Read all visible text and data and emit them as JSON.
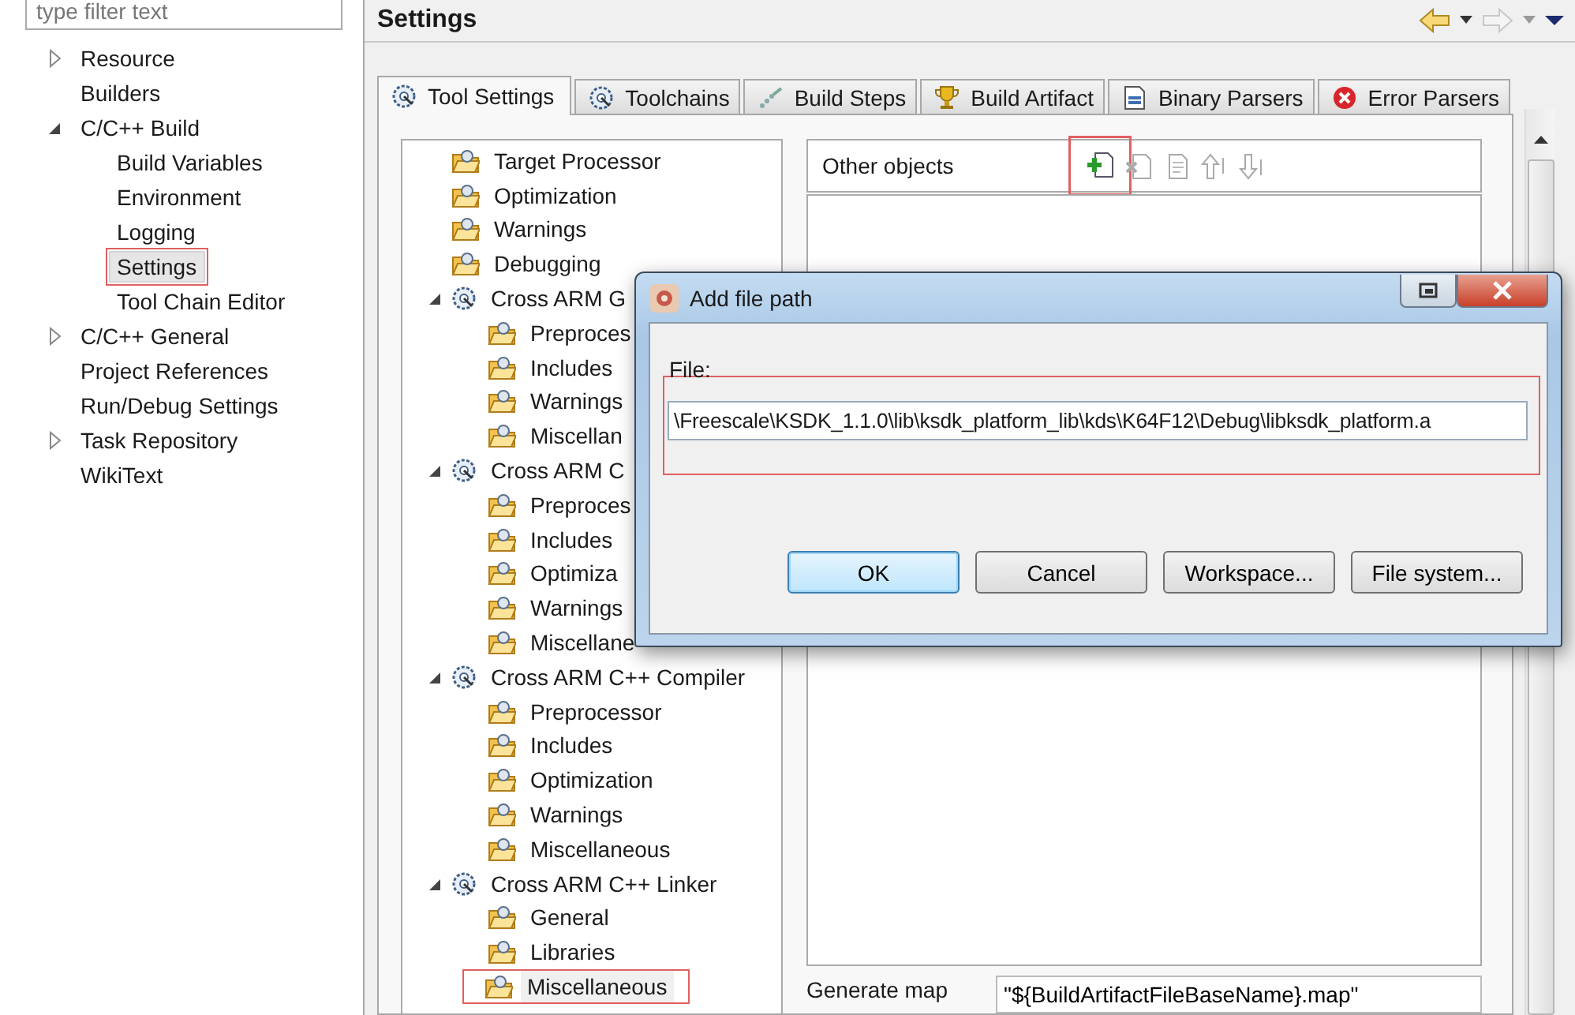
{
  "filter": {
    "placeholder": "type filter text"
  },
  "nav": [
    {
      "label": "Resource",
      "expanded": false,
      "selected": false,
      "marked": false
    },
    {
      "label": "Builders",
      "selected": false,
      "marked": false
    },
    {
      "label": "C/C++ Build",
      "expanded": true,
      "selected": false,
      "marked": false,
      "children": [
        {
          "label": "Build Variables",
          "selected": false,
          "marked": false
        },
        {
          "label": "Environment",
          "selected": false,
          "marked": false
        },
        {
          "label": "Logging",
          "selected": false,
          "marked": false
        },
        {
          "label": "Settings",
          "selected": true,
          "marked": true
        },
        {
          "label": "Tool Chain Editor",
          "selected": false,
          "marked": false
        }
      ]
    },
    {
      "label": "C/C++ General",
      "expanded": false,
      "selected": false,
      "marked": false
    },
    {
      "label": "Project References",
      "selected": false,
      "marked": false
    },
    {
      "label": "Run/Debug Settings",
      "selected": false,
      "marked": false
    },
    {
      "label": "Task Repository",
      "expanded": false,
      "selected": false,
      "marked": false
    },
    {
      "label": "WikiText",
      "selected": false,
      "marked": false
    }
  ],
  "header": {
    "title": "Settings"
  },
  "tabs": [
    {
      "label": "Tool Settings",
      "kind": "gear",
      "selected": true
    },
    {
      "label": "Toolchains",
      "kind": "gear",
      "selected": false
    },
    {
      "label": "Build Steps",
      "kind": "steps",
      "selected": false
    },
    {
      "label": "Build Artifact",
      "kind": "trophy",
      "selected": false
    },
    {
      "label": "Binary Parsers",
      "kind": "binary",
      "selected": false
    },
    {
      "label": "Error Parsers",
      "kind": "error",
      "selected": false
    }
  ],
  "tool_tree": [
    {
      "label": "Target Processor",
      "kind": "page",
      "selected": false,
      "marked": false
    },
    {
      "label": "Optimization",
      "kind": "page",
      "selected": false,
      "marked": false
    },
    {
      "label": "Warnings",
      "kind": "page",
      "selected": false,
      "marked": false
    },
    {
      "label": "Debugging",
      "kind": "page",
      "selected": false,
      "marked": false
    },
    {
      "label": "Cross ARM G",
      "kind": "tool",
      "expanded": true,
      "selected": false,
      "marked": false,
      "children": [
        {
          "label": "Preproces",
          "kind": "page",
          "selected": false,
          "marked": false
        },
        {
          "label": "Includes",
          "kind": "page",
          "selected": false,
          "marked": false
        },
        {
          "label": "Warnings",
          "kind": "page",
          "selected": false,
          "marked": false
        },
        {
          "label": "Miscellan",
          "kind": "page",
          "selected": false,
          "marked": false
        }
      ]
    },
    {
      "label": "Cross ARM C",
      "kind": "tool",
      "expanded": true,
      "selected": false,
      "marked": false,
      "children": [
        {
          "label": "Preproces",
          "kind": "page",
          "selected": false,
          "marked": false
        },
        {
          "label": "Includes",
          "kind": "page",
          "selected": false,
          "marked": false
        },
        {
          "label": "Optimiza",
          "kind": "page",
          "selected": false,
          "marked": false
        },
        {
          "label": "Warnings",
          "kind": "page",
          "selected": false,
          "marked": false
        },
        {
          "label": "Miscellane",
          "kind": "page",
          "selected": false,
          "marked": false
        }
      ]
    },
    {
      "label": "Cross ARM C++ Compiler",
      "kind": "tool",
      "expanded": true,
      "selected": false,
      "marked": false,
      "children": [
        {
          "label": "Preprocessor",
          "kind": "page",
          "selected": false,
          "marked": false
        },
        {
          "label": "Includes",
          "kind": "page",
          "selected": false,
          "marked": false
        },
        {
          "label": "Optimization",
          "kind": "page",
          "selected": false,
          "marked": false
        },
        {
          "label": "Warnings",
          "kind": "page",
          "selected": false,
          "marked": false
        },
        {
          "label": "Miscellaneous",
          "kind": "page",
          "selected": false,
          "marked": false
        }
      ]
    },
    {
      "label": "Cross ARM C++ Linker",
      "kind": "tool",
      "expanded": true,
      "selected": false,
      "marked": false,
      "children": [
        {
          "label": "General",
          "kind": "page",
          "selected": false,
          "marked": false
        },
        {
          "label": "Libraries",
          "kind": "page",
          "selected": false,
          "marked": false
        },
        {
          "label": "Miscellaneous",
          "kind": "page",
          "selected": true,
          "marked": true
        }
      ]
    }
  ],
  "objects": {
    "label": "Other objects",
    "toolbar": [
      {
        "kind": "add",
        "disabled": false,
        "marked": true
      },
      {
        "kind": "delete",
        "disabled": true,
        "marked": false
      },
      {
        "kind": "edit",
        "disabled": true,
        "marked": false
      },
      {
        "kind": "up",
        "disabled": true,
        "marked": false
      },
      {
        "kind": "down",
        "disabled": true,
        "marked": false
      }
    ]
  },
  "generate_map": {
    "label": "Generate map",
    "value": "\"${BuildArtifactFileBaseName}.map\""
  },
  "dialog": {
    "title": "Add file path",
    "file_label": "File:",
    "file_value": "\\Freescale\\KSDK_1.1.0\\lib\\ksdk_platform_lib\\kds\\K64F12\\Debug\\libksdk_platform.a",
    "field_marked": true,
    "buttons": [
      {
        "label": "OK",
        "default": true
      },
      {
        "label": "Cancel",
        "default": false
      },
      {
        "label": "Workspace...",
        "default": false
      },
      {
        "label": "File system...",
        "default": false
      }
    ]
  }
}
